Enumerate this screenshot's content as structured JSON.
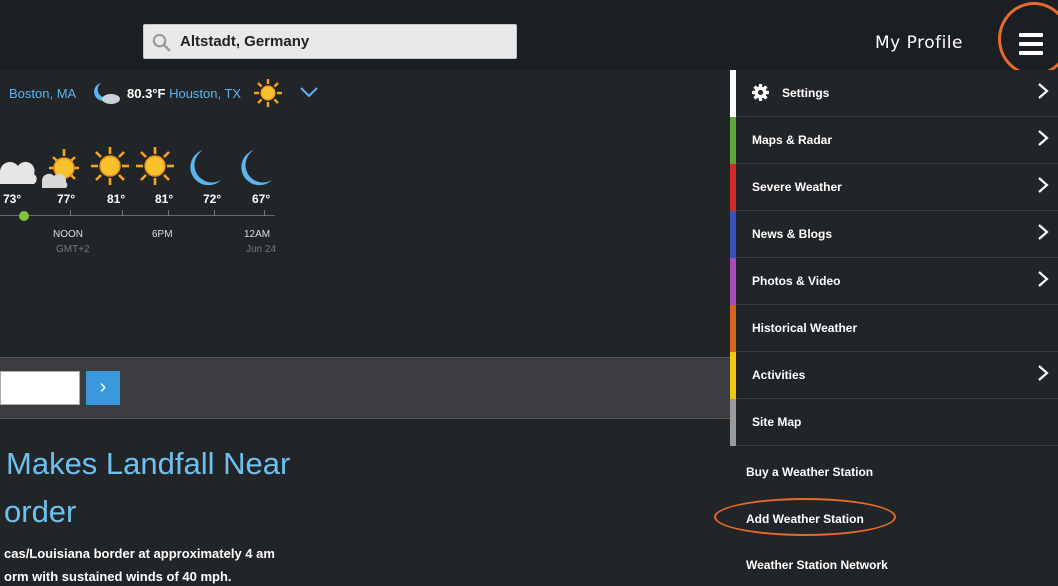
{
  "search": {
    "value": "Altstadt, Germany",
    "icon": "search-icon"
  },
  "header": {
    "profile_label": "My Profile",
    "menu_icon": "hamburger-icon"
  },
  "accent": {
    "highlight": "#e86b2a",
    "link": "#5ab4ee",
    "button": "#3a99dd"
  },
  "cities": [
    {
      "temp": "",
      "name": "Boston, MA",
      "icon": "moon-cloud-icon"
    },
    {
      "temp": "80.3°F",
      "name": "Houston, TX",
      "icon": "sun-icon"
    }
  ],
  "cities_more_icon": "chevron-down-icon",
  "forecast": {
    "temps": [
      "73°",
      "77°",
      "81°",
      "81°",
      "72°",
      "67°"
    ],
    "icons": [
      "cloud-icon",
      "sun-cloud-icon",
      "sun-icon",
      "sun-icon",
      "moon-icon",
      "moon-icon"
    ],
    "time_labels": [
      "NOON",
      "6PM",
      "12AM"
    ],
    "sub_labels": [
      "GMT+2",
      "Jun 24"
    ]
  },
  "strip": {
    "button_label": "›"
  },
  "article": {
    "headline_line1": "Makes Landfall Near",
    "headline_line2": "order",
    "body_line1": "cas/Louisiana border at approximately 4 am",
    "body_line2": "orm with sustained winds of 40 mph."
  },
  "menu": {
    "items": [
      {
        "label": "Settings",
        "color": "#ffffff",
        "arrow": true
      },
      {
        "label": "Maps & Radar",
        "color": "#5aa83a",
        "arrow": true
      },
      {
        "label": "Severe Weather",
        "color": "#d42a2a",
        "arrow": true
      },
      {
        "label": "News & Blogs",
        "color": "#3553b8",
        "arrow": true
      },
      {
        "label": "Photos & Video",
        "color": "#a64db5",
        "arrow": true
      },
      {
        "label": "Historical Weather",
        "color": "#d4641e",
        "arrow": false
      },
      {
        "label": "Activities",
        "color": "#f2c713",
        "arrow": true
      },
      {
        "label": "Site Map",
        "color": "#9a9a9a",
        "arrow": false
      }
    ],
    "plain_items": [
      "Buy a Weather Station",
      "Add Weather Station",
      "Weather Station Network"
    ]
  }
}
